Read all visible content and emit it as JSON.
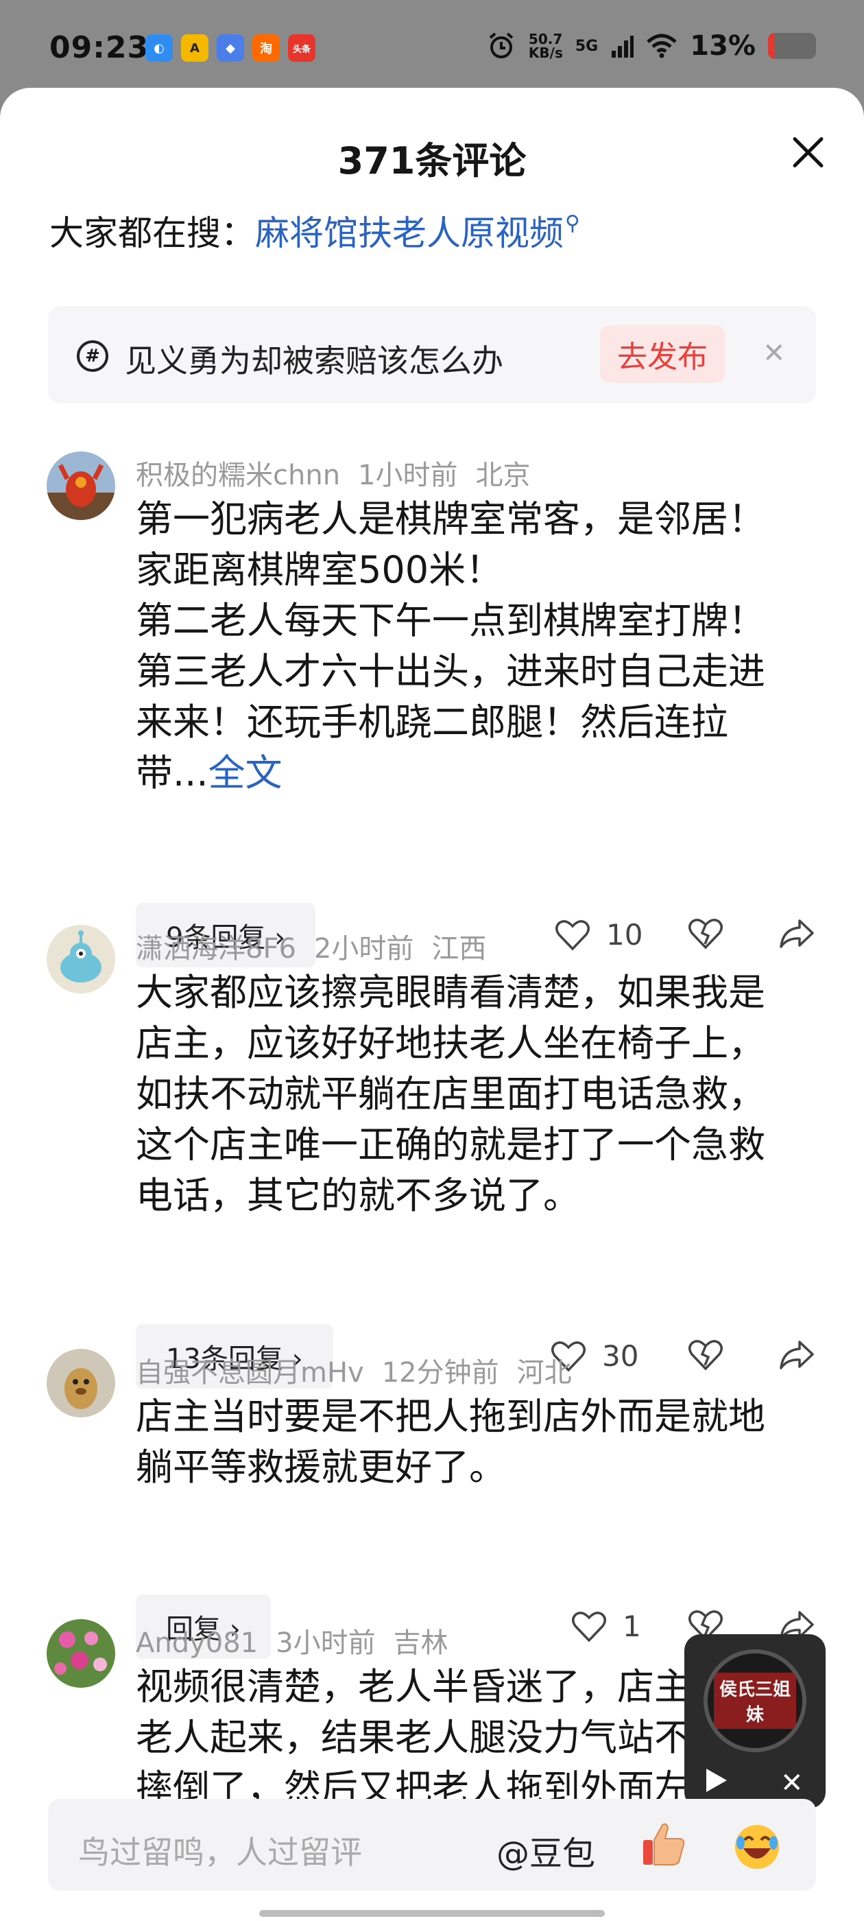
{
  "status_bar": {
    "time": "09:23",
    "net_speed_value": "50.7",
    "net_speed_unit": "KB/s",
    "network": "5G",
    "battery_text": "13%",
    "battery_level": 0.13,
    "app_icons": [
      "browser-icon",
      "app-a-icon",
      "app-blue-icon",
      "taobao-icon",
      "toutiao-icon"
    ],
    "taobao_label": "淘",
    "toutiao_label": "头条"
  },
  "header": {
    "title": "371条评论"
  },
  "search": {
    "label": "大家都在搜：",
    "link": "麻将馆扶老人原视频"
  },
  "prompt": {
    "text": "见义勇为却被索赔该怎么办",
    "button": "去发布"
  },
  "comments": [
    {
      "username": "积极的糯米chnn",
      "time": "1小时前",
      "location": "北京",
      "lines": [
        "第一犯病老人是棋牌室常客，是邻居！",
        "家距离棋牌室500米！",
        "第二老人每天下午一点到棋牌室打牌！",
        "第三老人才六十出头，进来时自己走进",
        "来来！还玩手机跷二郎腿！然后连拉",
        "带..."
      ],
      "full_text_link": "全文",
      "reply_label": "9条回复 ›",
      "likes": "10"
    },
    {
      "username": "潇洒海洋8F6",
      "time": "2小时前",
      "location": "江西",
      "lines": [
        "大家都应该擦亮眼睛看清楚，如果我是",
        "店主，应该好好地扶老人坐在椅子上，",
        "如扶不动就平躺在店里面打电话急救，",
        "这个店主唯一正确的就是打了一个急救",
        "电话，其它的就不多说了。"
      ],
      "reply_label": "13条回复 ›",
      "likes": "30"
    },
    {
      "username": "自强不息圆月mHv",
      "time": "12分钟前",
      "location": "河北",
      "lines": [
        "店主当时要是不把人拖到店外而是就地",
        "躺平等救援就更好了。"
      ],
      "reply_label": "回复 ›",
      "likes": "1"
    },
    {
      "username": "Andy081",
      "time": "3小时前",
      "location": "吉林",
      "lines": [
        "视频很清楚，老人半昏迷了，店主",
        "老人起来，结果老人腿没力气站不住，",
        "摔倒了，然后又把老人拖到外面左到只"
      ]
    }
  ],
  "mini_player": {
    "cover_text": "侯氏三姐妹"
  },
  "input_bar": {
    "placeholder": "鸟过留鸣，人过留评",
    "mention": "@豆包"
  },
  "colors": {
    "accent_blue": "#2a63c0",
    "publish_red": "#e8403b",
    "publish_bg": "#fde6e6",
    "battery_red": "#e13a32"
  }
}
